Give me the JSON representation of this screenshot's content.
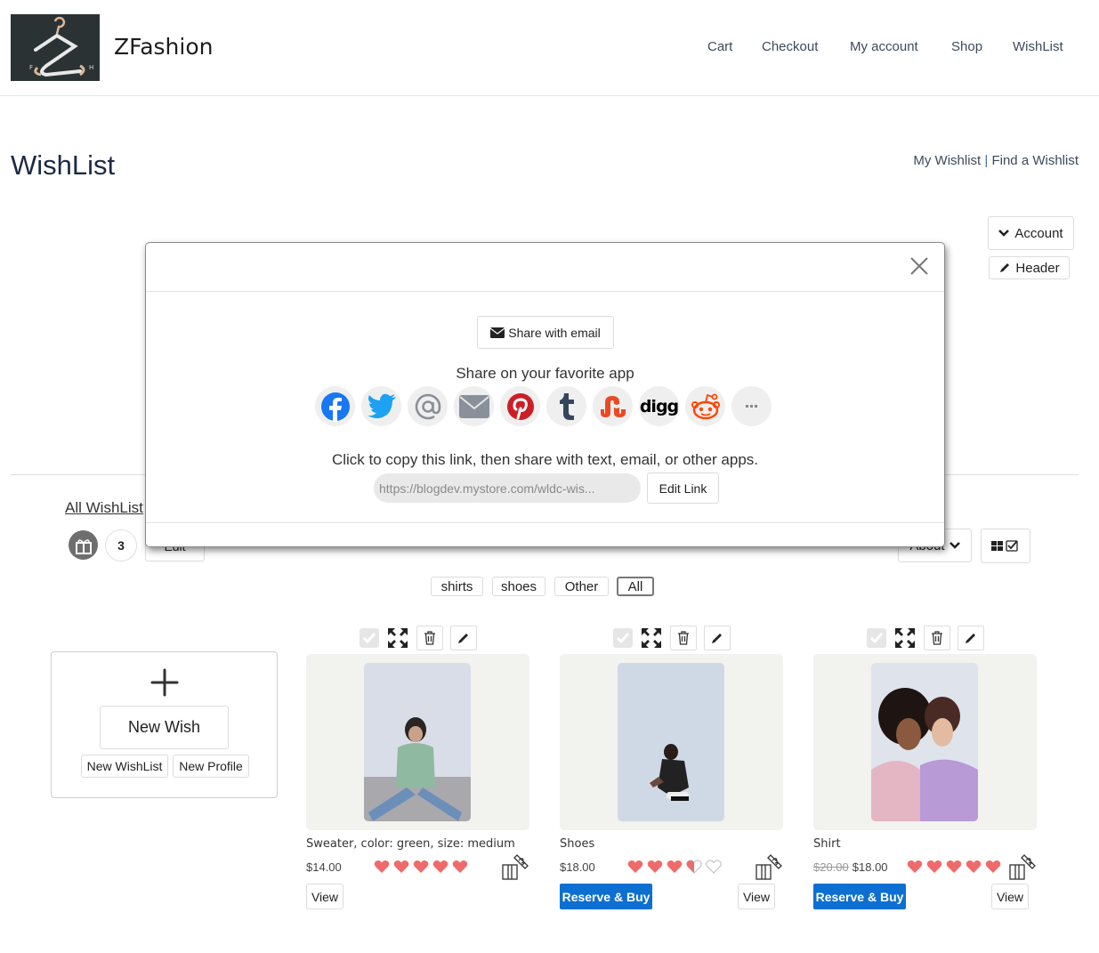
{
  "header": {
    "brand": "ZFashion",
    "logo_letters": [
      "F",
      "H"
    ],
    "nav": [
      "Cart",
      "Checkout",
      "My account",
      "Shop",
      "WishList"
    ]
  },
  "page": {
    "title": "WishList",
    "my_wishlist_link": "My Wishlist",
    "separator": "|",
    "find_wishlist_link": "Find a Wishlist",
    "account_button": "Account",
    "header_button": "Header"
  },
  "modal": {
    "share_email_label": "Share with email",
    "share_title": "Share on your favorite app",
    "apps": [
      {
        "name": "facebook",
        "color": "#1877f2"
      },
      {
        "name": "twitter",
        "color": "#1da1f2"
      },
      {
        "name": "at-sign",
        "color": "#8a9099"
      },
      {
        "name": "email",
        "color": "#8a9099"
      },
      {
        "name": "pinterest",
        "color": "#cb1f27"
      },
      {
        "name": "tumblr",
        "color": "#35465c"
      },
      {
        "name": "stumbleupon",
        "color": "#eb4924"
      },
      {
        "name": "digg",
        "color": "#000000"
      },
      {
        "name": "reddit",
        "color": "#ff4500"
      },
      {
        "name": "more",
        "color": "#888888"
      }
    ],
    "digg_text": "digg",
    "copy_text": "Click to copy this link, then share with text, email, or other apps.",
    "link_value": "https://blogdev.mystore.com/wldc-wis...",
    "edit_link_label": "Edit Link"
  },
  "list": {
    "all_wishlist_link": "All WishList",
    "count": "3",
    "edit_label": "Edit",
    "about_label": "About",
    "filters": [
      {
        "label": "shirts",
        "active": false
      },
      {
        "label": "shoes",
        "active": false
      },
      {
        "label": "Other",
        "active": false
      },
      {
        "label": "All",
        "active": true
      }
    ]
  },
  "new_card": {
    "new_wish": "New Wish",
    "new_wishlist": "New WishList",
    "new_profile": "New Profile"
  },
  "products": [
    {
      "name": "Sweater, color: green, size: medium",
      "old_price": "",
      "price": "$14.00",
      "rating": 5,
      "reserve_label": "",
      "view_label": "View"
    },
    {
      "name": "Shoes",
      "old_price": "",
      "price": "$18.00",
      "rating": 3.5,
      "reserve_label": "Reserve & Buy",
      "view_label": "View"
    },
    {
      "name": "Shirt",
      "old_price": "$20.00",
      "price": "$18.00",
      "rating": 5,
      "reserve_label": "Reserve & Buy",
      "view_label": "View"
    }
  ],
  "colors": {
    "heart": "#ef6b6b",
    "reserve": "#0d6fd1"
  }
}
